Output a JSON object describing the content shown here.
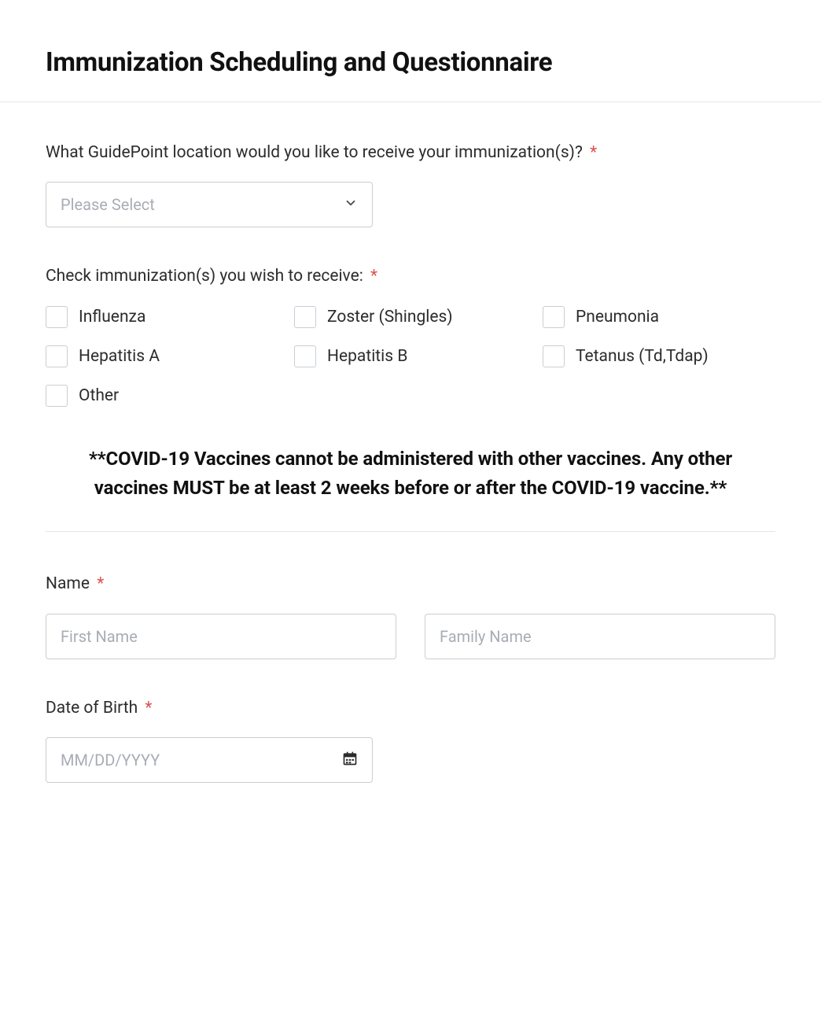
{
  "header": {
    "title": "Immunization Scheduling and Questionnaire"
  },
  "location": {
    "label": "What GuidePoint location would you like to receive your immunization(s)?",
    "required": "*",
    "placeholder": "Please Select"
  },
  "immunizations": {
    "label": "Check immunization(s) you wish to receive:",
    "required": "*",
    "options": [
      "Influenza",
      "Zoster (Shingles)",
      "Pneumonia",
      "Hepatitis A",
      "Hepatitis B",
      "Tetanus (Td,Tdap)",
      "Other"
    ]
  },
  "notice": {
    "text": "**COVID-19 Vaccines cannot be administered with other vaccines. Any other vaccines MUST be at least 2 weeks before or after the COVID-19 vaccine.**"
  },
  "name": {
    "label": "Name",
    "required": "*",
    "first_placeholder": "First Name",
    "family_placeholder": "Family Name"
  },
  "dob": {
    "label": "Date of Birth",
    "required": "*",
    "placeholder": "MM/DD/YYYY"
  }
}
